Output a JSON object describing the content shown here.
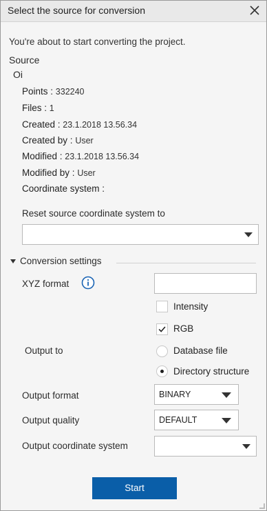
{
  "window": {
    "title": "Select the source for conversion",
    "close_icon": "close-icon"
  },
  "intro": "You're about to start converting the project.",
  "source": {
    "heading": "Source",
    "name": "Oi",
    "fields": [
      {
        "key": "Points :",
        "value": "332240"
      },
      {
        "key": "Files :",
        "value": "1"
      },
      {
        "key": "Created :",
        "value": "23.1.2018 13.56.34"
      },
      {
        "key": "Created by :",
        "value": "User"
      },
      {
        "key": "Modified :",
        "value": "23.1.2018 13.56.34"
      },
      {
        "key": "Modified by :",
        "value": "User"
      },
      {
        "key": "Coordinate system :",
        "value": ""
      }
    ]
  },
  "reset": {
    "label": "Reset source coordinate system to",
    "value": ""
  },
  "conversion": {
    "section_label": "Conversion settings",
    "xyz_format_label": "XYZ format",
    "xyz_format_value": "",
    "intensity_label": "Intensity",
    "intensity_checked": false,
    "rgb_label": "RGB",
    "rgb_checked": true,
    "output_to_label": "Output to",
    "output_to_options": [
      "Database file",
      "Directory structure"
    ],
    "output_to_selected": "Directory structure",
    "output_format_label": "Output format",
    "output_format_value": "BINARY",
    "output_quality_label": "Output quality",
    "output_quality_value": "DEFAULT",
    "output_cs_label": "Output coordinate system",
    "output_cs_value": ""
  },
  "start_label": "Start",
  "colors": {
    "accent": "#0a5ea8",
    "info_icon": "#1a64b4"
  }
}
